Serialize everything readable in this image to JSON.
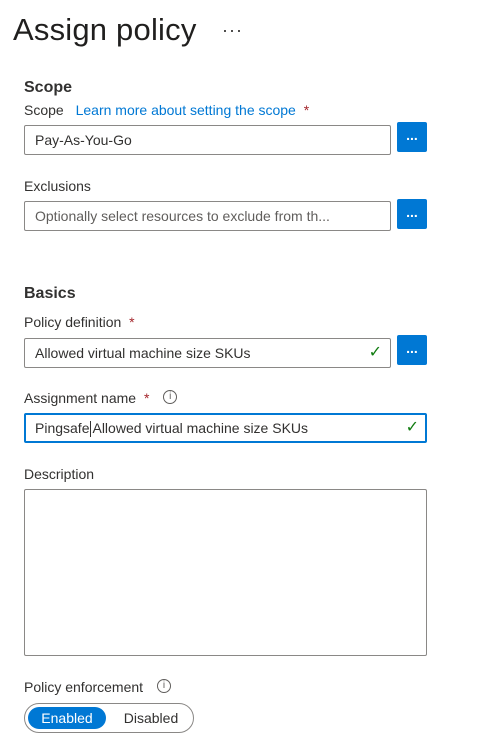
{
  "header": {
    "title": "Assign policy",
    "more_label": "···"
  },
  "scope_section": {
    "title": "Scope",
    "scope_label": "Scope",
    "scope_link": "Learn more about setting the scope",
    "required_mark": "*",
    "scope_value": "Pay-As-You-Go",
    "browse_label": "...",
    "exclusions_label": "Exclusions",
    "exclusions_placeholder": "Optionally select resources to exclude from th..."
  },
  "basics_section": {
    "title": "Basics",
    "policy_definition_label": "Policy definition",
    "policy_definition_value": "Allowed virtual machine size SKUs",
    "assignment_name_label": "Assignment name",
    "assignment_name_value_part1": "Pingsafe",
    "assignment_name_value_part2": "Allowed virtual machine size SKUs",
    "description_label": "Description",
    "description_value": "",
    "enforcement_label": "Policy enforcement",
    "enforcement_options": [
      "Enabled",
      "Disabled"
    ],
    "enforcement_selected": "Enabled"
  },
  "icons": {
    "check": "checkmark-icon",
    "info": "info-icon"
  },
  "colors": {
    "accent": "#0078d4",
    "required": "#a4262c",
    "success": "#107c10"
  }
}
